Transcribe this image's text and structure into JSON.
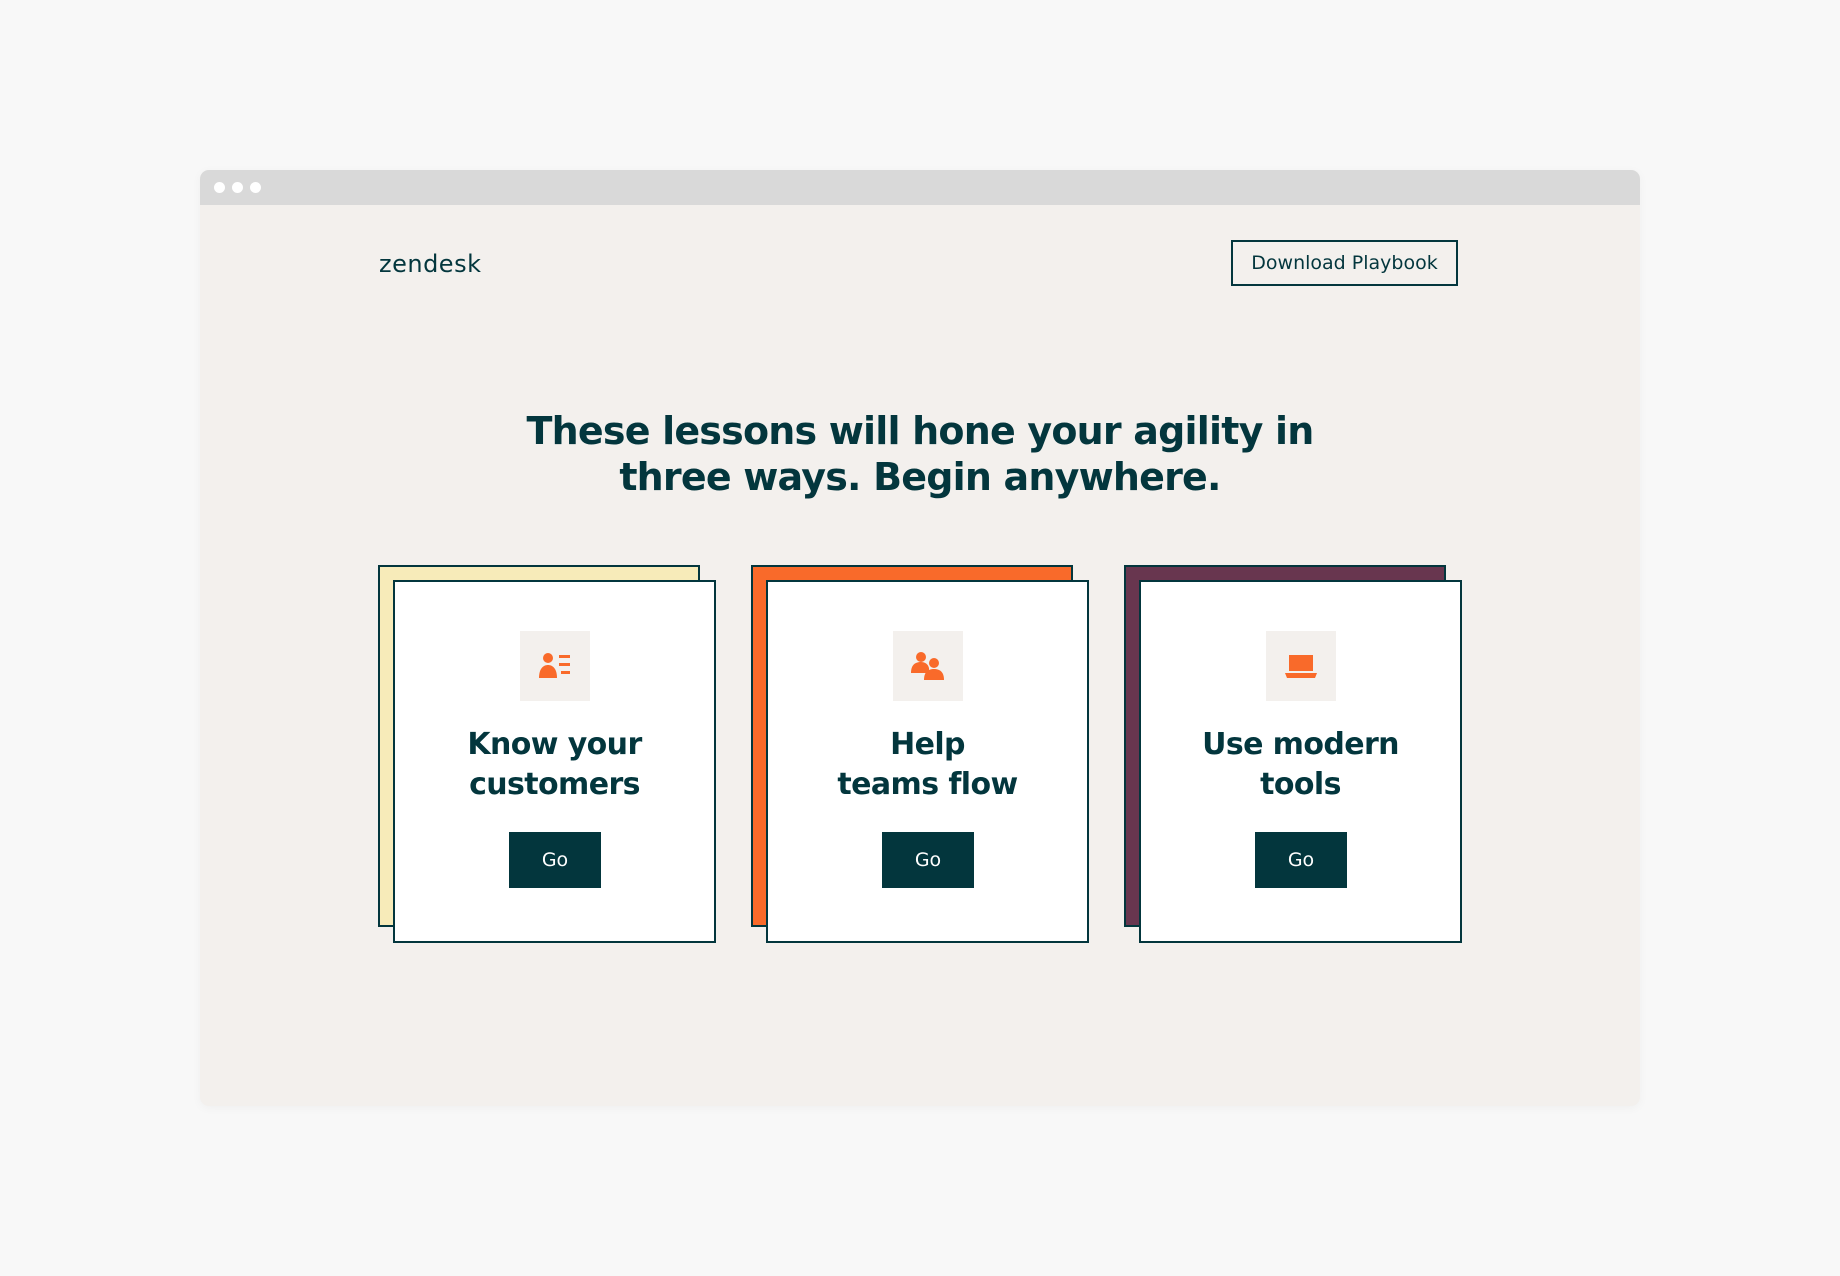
{
  "window": {
    "dots": 3
  },
  "header": {
    "logo": "zendesk",
    "download_label": "Download Playbook"
  },
  "headline": {
    "line1": "These lessons will hone your agility in",
    "line2": "three ways. Begin anywhere."
  },
  "cards": [
    {
      "title_line1": "Know your",
      "title_line2": "customers",
      "button_label": "Go",
      "icon": "customer-profile-icon",
      "back_color": "#f7ebb9"
    },
    {
      "title_line1": "Help",
      "title_line2": "teams flow",
      "button_label": "Go",
      "icon": "team-people-icon",
      "back_color": "#f96a2a"
    },
    {
      "title_line1": "Use modern",
      "title_line2": "tools",
      "button_label": "Go",
      "icon": "laptop-icon",
      "back_color": "#68364f"
    }
  ],
  "colors": {
    "primary": "#03363d",
    "accent": "#f96a2a",
    "page_bg": "#f3f0ed"
  }
}
